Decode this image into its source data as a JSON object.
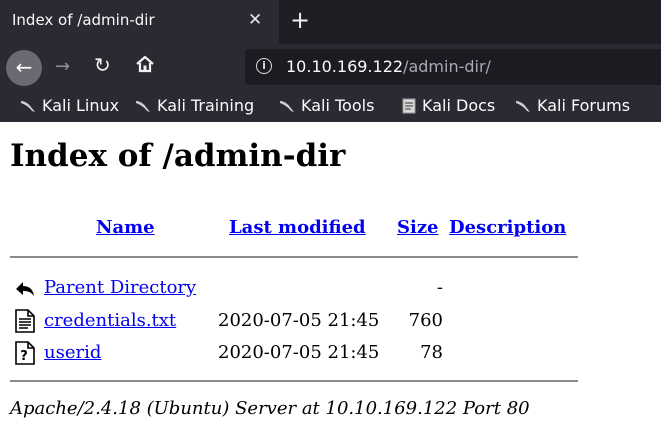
{
  "browser": {
    "tab_title": "Index of /admin-dir",
    "tab_close": "✕",
    "new_tab": "+",
    "url_host": "10.10.169.122",
    "url_path": "/admin-dir/"
  },
  "bookmarks": [
    {
      "label": "Kali Linux",
      "icon": "kali-dragon-icon"
    },
    {
      "label": "Kali Training",
      "icon": "kali-dragon-icon"
    },
    {
      "label": "Kali Tools",
      "icon": "kali-dragon-icon"
    },
    {
      "label": "Kali Docs",
      "icon": "kali-docs-icon"
    },
    {
      "label": "Kali Forums",
      "icon": "kali-dragon-icon"
    }
  ],
  "page": {
    "heading": "Index of /admin-dir",
    "columns": {
      "name": "Name",
      "last_modified": "Last modified",
      "size": "Size",
      "description": "Description"
    },
    "rows": [
      {
        "name": "Parent Directory",
        "date": "",
        "size": "-",
        "icon": "back-arrow-icon"
      },
      {
        "name": "credentials.txt",
        "date": "2020-07-05 21:45",
        "size": "760",
        "icon": "text-file-icon"
      },
      {
        "name": "userid",
        "date": "2020-07-05 21:45",
        "size": "78",
        "icon": "unknown-file-icon"
      }
    ],
    "footer": "Apache/2.4.18 (Ubuntu) Server at 10.10.169.122 Port 80"
  },
  "colors": {
    "chrome_dark": "#2b2a33",
    "tabstrip": "#1e1e24",
    "link": "#0000ee"
  }
}
